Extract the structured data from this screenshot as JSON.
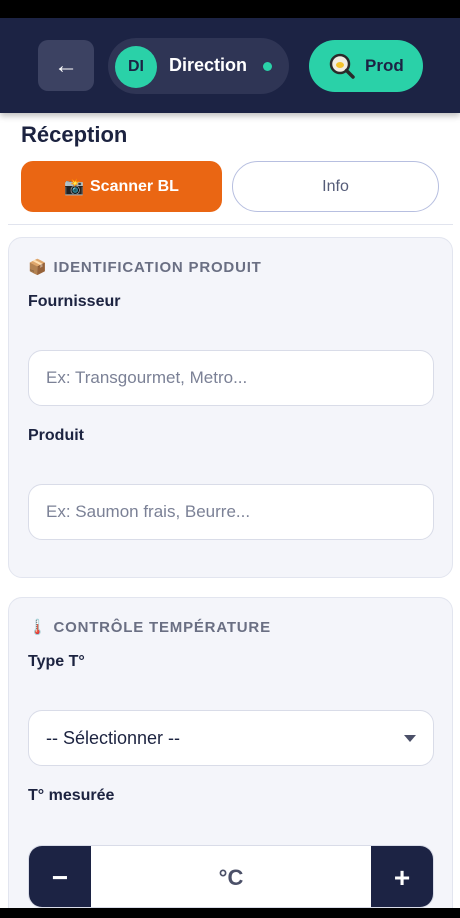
{
  "header": {
    "back_symbol": "←",
    "avatar_initials": "DI",
    "user_name": "Direction",
    "status_color": "#2ad1a8",
    "prod_icon": "magnifier-pan-icon",
    "prod_label": "Prod"
  },
  "page": {
    "title": "Réception"
  },
  "tabs": {
    "scan_icon": "📸",
    "scan_label": "Scanner BL",
    "info_label": "Info"
  },
  "identification": {
    "icon": "📦",
    "title": "IDENTIFICATION PRODUIT",
    "supplier_label": "Fournisseur",
    "supplier_placeholder": "Ex: Transgourmet, Metro...",
    "product_label": "Produit",
    "product_placeholder": "Ex: Saumon frais, Beurre..."
  },
  "temperature": {
    "icon": "🌡️",
    "title": "CONTRÔLE TEMPÉRATURE",
    "type_label": "Type T°",
    "type_selected": "-- Sélectionner --",
    "measured_label": "T° mesurée",
    "minus": "−",
    "unit": "°C",
    "plus": "+"
  },
  "colors": {
    "navy": "#1c2344",
    "accent_green": "#2ad1a8",
    "accent_orange": "#ea6613"
  }
}
